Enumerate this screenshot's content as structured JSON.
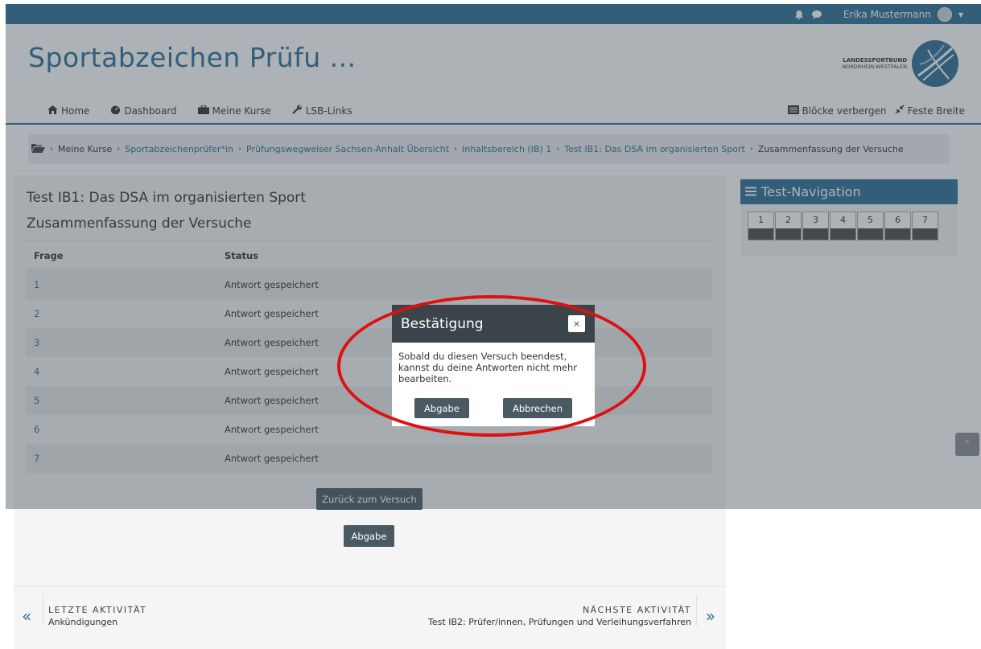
{
  "topbar": {
    "user_name": "Erika Mustermann",
    "bell_icon": "bell-icon",
    "chat_icon": "chat-icon"
  },
  "header": {
    "site_title": "Sportabzeichen Prüfu ...",
    "logo_line1": "LANDESSPORTBUND",
    "logo_line2": "NORDRHEIN-WESTFALEN",
    "nav": [
      {
        "label": "Home",
        "icon": "home-icon"
      },
      {
        "label": "Dashboard",
        "icon": "dashboard-icon"
      },
      {
        "label": "Meine Kurse",
        "icon": "briefcase-icon"
      },
      {
        "label": "LSB-Links",
        "icon": "wrench-icon"
      }
    ],
    "hide_blocks": "Blöcke verbergen",
    "fixed_width": "Feste Breite"
  },
  "breadcrumb": [
    "Meine Kurse",
    "Sportabzeichenprüfer*in",
    "Prüfungswegweiser Sachsen-Anhalt Übersicht",
    "Inhaltsbereich (IB) 1",
    "Test IB1: Das DSA im organisierten Sport",
    "Zusammenfassung der Versuche"
  ],
  "main": {
    "title": "Test IB1: Das DSA im organisierten Sport",
    "subtitle": "Zusammenfassung der Versuche",
    "col_question": "Frage",
    "col_status": "Status",
    "rows": [
      {
        "q": "1",
        "status": "Antwort gespeichert"
      },
      {
        "q": "2",
        "status": "Antwort gespeichert"
      },
      {
        "q": "3",
        "status": "Antwort gespeichert"
      },
      {
        "q": "4",
        "status": "Antwort gespeichert"
      },
      {
        "q": "5",
        "status": "Antwort gespeichert"
      },
      {
        "q": "6",
        "status": "Antwort gespeichert"
      },
      {
        "q": "7",
        "status": "Antwort gespeichert"
      }
    ],
    "back_button": "Zurück zum Versuch",
    "submit_button": "Abgabe"
  },
  "activity": {
    "prev_caption": "LETZTE AKTIVITÄT",
    "prev_name": "Ankündigungen",
    "next_caption": "NÄCHSTE AKTIVITÄT",
    "next_name": "Test IB2: Prüfer/innen, Prüfungen und Verleihungsverfahren"
  },
  "block": {
    "title": "Test-Navigation",
    "questions": [
      "1",
      "2",
      "3",
      "4",
      "5",
      "6",
      "7"
    ]
  },
  "modal": {
    "title": "Bestätigung",
    "close": "×",
    "body": "Sobald du diesen Versuch beendest, kannst du deine Antworten nicht mehr bearbeiten.",
    "submit": "Abgabe",
    "cancel": "Abbrechen"
  },
  "colors": {
    "brand": "#2e6f96",
    "button": "#4a5a63",
    "annotation": "#e01010"
  }
}
